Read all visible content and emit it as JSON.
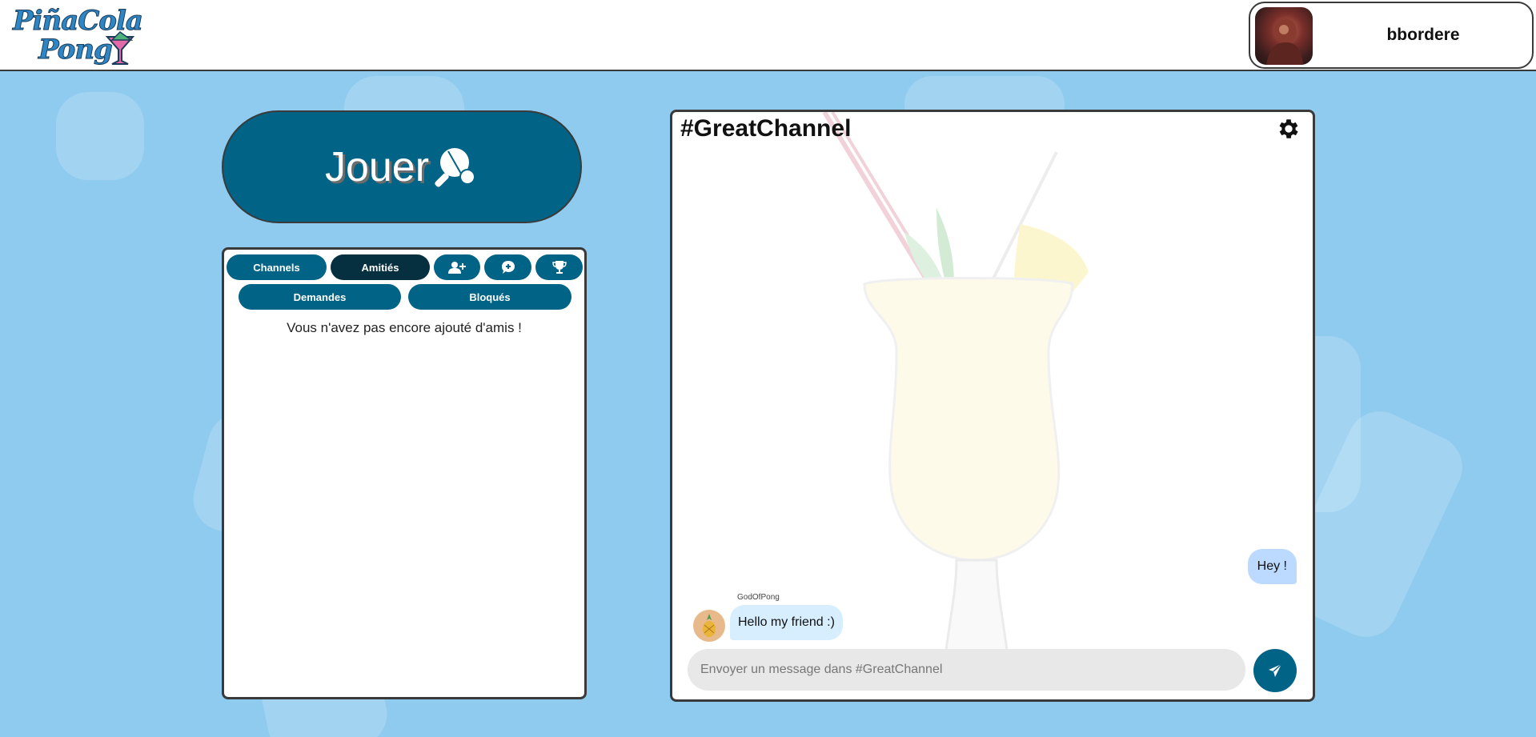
{
  "header": {
    "logo_text_line1": "PiñaCola",
    "logo_text_line2": "Pong",
    "username": "bbordere"
  },
  "play": {
    "label": "Jouer"
  },
  "friends_panel": {
    "tabs": [
      {
        "label": "Channels",
        "active": false
      },
      {
        "label": "Amitiés",
        "active": true
      }
    ],
    "icon_tabs": [
      "add-friend-icon",
      "chat-plus-icon",
      "trophy-icon"
    ],
    "subtabs": [
      {
        "label": "Demandes"
      },
      {
        "label": "Bloqués"
      }
    ],
    "empty_message": "Vous n'avez pas encore ajouté d'amis !"
  },
  "chat": {
    "title": "#GreatChannel",
    "messages": [
      {
        "side": "right",
        "text": "Hey !"
      },
      {
        "side": "left",
        "sender": "GodOfPong",
        "text": "Hello my friend :)"
      }
    ],
    "input_placeholder": "Envoyer un message dans #GreatChannel"
  },
  "colors": {
    "background": "#8ecbef",
    "primary": "#016385",
    "tab_active": "#06303f",
    "bubble_self": "#bcd9ff",
    "bubble_other": "#d7eeff"
  }
}
